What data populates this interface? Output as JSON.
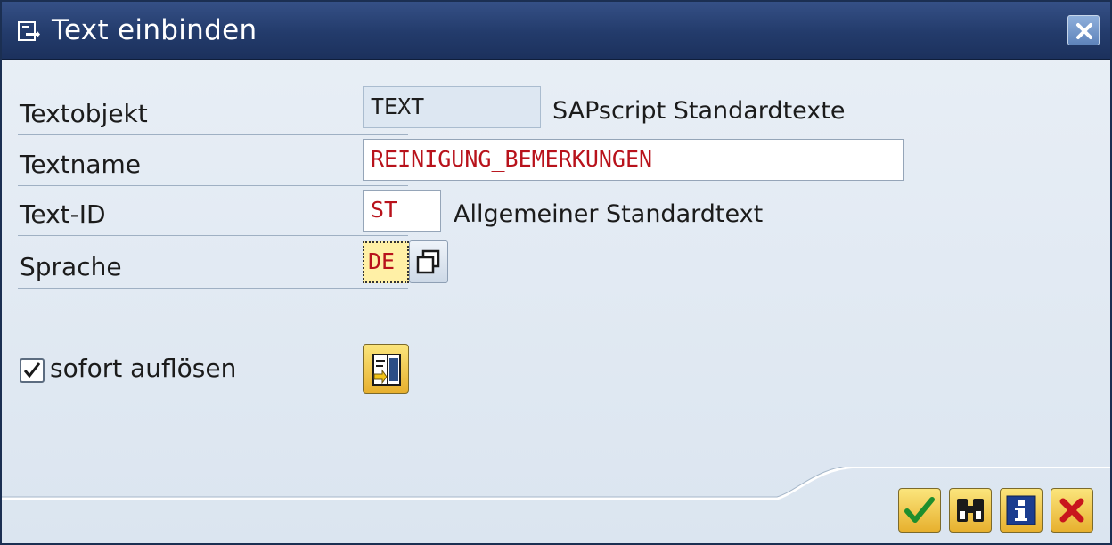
{
  "window": {
    "title": "Text einbinden",
    "title_icon": "insert-text-icon",
    "close_icon": "close-icon"
  },
  "form": {
    "textobjekt": {
      "label": "Textobjekt",
      "value": "TEXT",
      "description": "SAPscript Standardtexte"
    },
    "textname": {
      "label": "Textname",
      "value": "REINIGUNG_BEMERKUNGEN"
    },
    "text_id": {
      "label": "Text-ID",
      "value": "ST",
      "description": "Allgemeiner Standardtext"
    },
    "sprache": {
      "label": "Sprache",
      "value": "DE",
      "help_icon": "value-help-icon"
    }
  },
  "options": {
    "sofort_aufloesen": {
      "label": "sofort auflösen",
      "checked": true
    },
    "resolve_button_icon": "expand-text-icon"
  },
  "toolbar": {
    "confirm_icon": "checkmark-icon",
    "find_icon": "binoculars-icon",
    "info_icon": "info-icon",
    "cancel_icon": "cancel-x-icon"
  },
  "colors": {
    "title_bar": "#233b6b",
    "input_text": "#b8121b",
    "focused_field": "#fff0a6",
    "toolbar_button": "#f5cc4d"
  }
}
